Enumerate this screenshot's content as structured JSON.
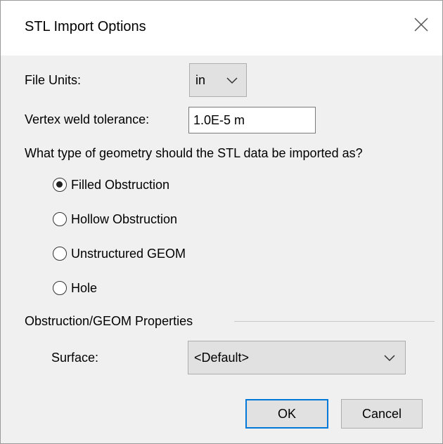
{
  "window": {
    "title": "STL Import Options",
    "close_icon": "close-icon"
  },
  "file_units": {
    "label": "File Units:",
    "selected": "in"
  },
  "vertex_weld": {
    "label": "Vertex weld tolerance:",
    "value": "1.0E-5 m"
  },
  "geometry": {
    "question": "What type of geometry should the STL data be imported as?",
    "options": [
      {
        "label": "Filled Obstruction",
        "checked": true
      },
      {
        "label": "Hollow Obstruction",
        "checked": false
      },
      {
        "label": "Unstructured GEOM",
        "checked": false
      },
      {
        "label": "Hole",
        "checked": false
      }
    ]
  },
  "properties": {
    "group_label": "Obstruction/GEOM Properties",
    "surface_label": "Surface:",
    "surface_selected": "<Default>"
  },
  "buttons": {
    "ok": "OK",
    "cancel": "Cancel"
  },
  "colors": {
    "dialog_bg": "#f0f0f0",
    "button_bg": "#e1e1e1",
    "default_button_border": "#0078d7"
  }
}
